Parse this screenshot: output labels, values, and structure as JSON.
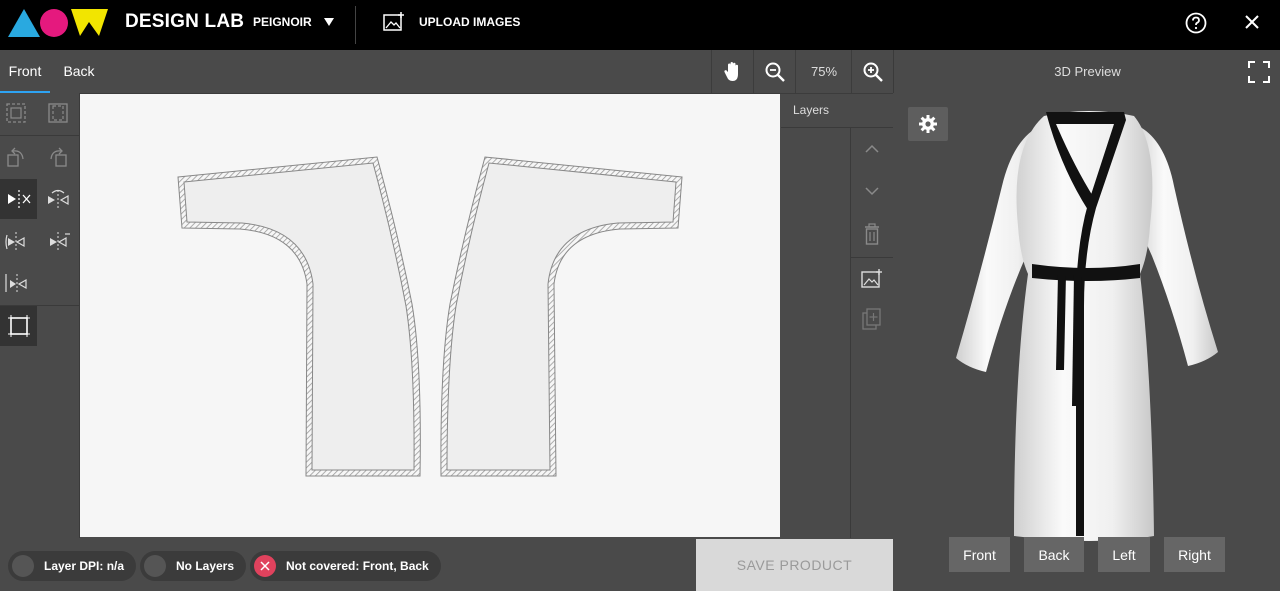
{
  "app": {
    "title": "DESIGN LAB",
    "brand_colors": [
      "#29a9e0",
      "#e5197e",
      "#f2e500"
    ]
  },
  "header": {
    "product": "PEIGNOIR",
    "upload_label": "UPLOAD IMAGES",
    "icons": {
      "help": "help-circle-icon",
      "close": "close-icon",
      "upload": "image-add-icon",
      "dropdown": "caret-down-icon"
    }
  },
  "tabs": [
    {
      "label": "Front",
      "active": true
    },
    {
      "label": "Back",
      "active": false
    }
  ],
  "zoom": {
    "level": "75%"
  },
  "preview": {
    "title": "3D Preview",
    "view_buttons": [
      "Front",
      "Back",
      "Left",
      "Right"
    ]
  },
  "layers": {
    "title": "Layers"
  },
  "status": {
    "dpi": {
      "label": "Layer DPI:",
      "value": "n/a"
    },
    "layers": {
      "label": "No Layers"
    },
    "coverage": {
      "label": "Not covered:",
      "value": "Front, Back"
    },
    "error_color": "#e0425d"
  },
  "actions": {
    "save_label": "SAVE PRODUCT"
  },
  "colors": {
    "accent": "#2ea3f2",
    "canvas": "#f6f6f6",
    "panel": "#4a4a4a",
    "topbar": "#000000"
  }
}
